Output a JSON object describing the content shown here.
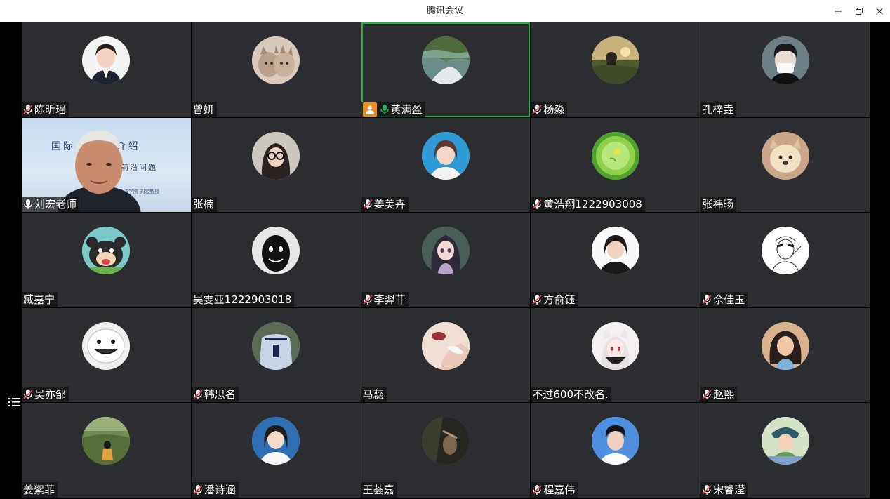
{
  "window": {
    "title": "腾讯会议"
  },
  "participants": [
    {
      "name": "陈昕瑶",
      "mic": "muted",
      "avatar": "girl-portrait"
    },
    {
      "name": "曾妍",
      "mic": "none",
      "avatar": "cats-photo"
    },
    {
      "name": "黄满盈",
      "mic": "on",
      "avatar": "lake-photo",
      "host": true,
      "active": true
    },
    {
      "name": "杨淼",
      "mic": "muted",
      "avatar": "sunset-photo"
    },
    {
      "name": "孔梓垚",
      "mic": "none",
      "avatar": "masked-boy"
    },
    {
      "name": "刘宏老师",
      "mic": "on",
      "video": true
    },
    {
      "name": "张楠",
      "mic": "none",
      "avatar": "girl-glasses"
    },
    {
      "name": "姜美卉",
      "mic": "muted",
      "avatar": "girl-portrait-blue"
    },
    {
      "name": "黄浩翔1222903008",
      "mic": "muted",
      "avatar": "green-lime"
    },
    {
      "name": "张祎旸",
      "mic": "none",
      "avatar": "dog-photo"
    },
    {
      "name": "臧嘉宁",
      "mic": "none",
      "avatar": "bear-cartoon"
    },
    {
      "name": "吴雯亚1222903018",
      "mic": "none",
      "avatar": "shadow-face"
    },
    {
      "name": "李羿菲",
      "mic": "muted",
      "avatar": "anime-girl"
    },
    {
      "name": "方俞钰",
      "mic": "muted",
      "avatar": "girl-portrait-white"
    },
    {
      "name": "佘佳玉",
      "mic": "muted",
      "avatar": "sketch-boy"
    },
    {
      "name": "吴亦邹",
      "mic": "muted",
      "avatar": "white-blob"
    },
    {
      "name": "韩思名",
      "mic": "muted",
      "avatar": "jersey-photo"
    },
    {
      "name": "马蕊",
      "mic": "none",
      "avatar": "lips-photo"
    },
    {
      "name": "不过600不改名.",
      "mic": "none",
      "avatar": "anime-cat-girl"
    },
    {
      "name": "赵熙",
      "mic": "muted",
      "avatar": "cartoon-girl"
    },
    {
      "name": "姜絮菲",
      "mic": "none",
      "avatar": "forest-photo"
    },
    {
      "name": "潘诗涵",
      "mic": "muted",
      "avatar": "girl-portrait-blue2"
    },
    {
      "name": "王荟嘉",
      "mic": "none",
      "avatar": "dark-photo"
    },
    {
      "name": "程嘉伟",
      "mic": "muted",
      "avatar": "boy-portrait"
    },
    {
      "name": "宋睿滢",
      "mic": "muted",
      "avatar": "cartoon-boy"
    }
  ],
  "video_slide": {
    "line1": "国际   易专业介绍",
    "line2": "贸易前沿问题",
    "line3": "经济学院 刘宏教授"
  },
  "colors": {
    "tile_bg": "#2b2d30",
    "active_border": "#22b24c",
    "host_badge": "#f08a1e",
    "mic_on": "#22b24c",
    "mic_muted_slash": "#e8454a"
  }
}
